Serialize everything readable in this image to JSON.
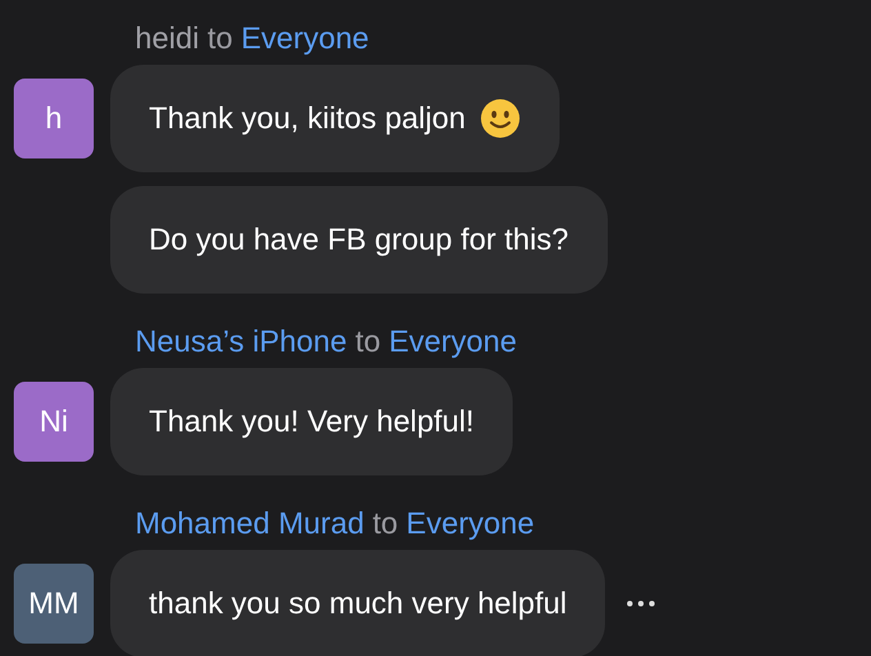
{
  "groups": [
    {
      "sender": "heidi",
      "color": "#a0a0a6",
      "connector": "to",
      "recipient": "Everyone",
      "avatar": {
        "initials": "h",
        "color": "#9b6bc8"
      },
      "messages": [
        {
          "text": "Thank you, kiitos paljon",
          "smiley": true,
          "more": false
        },
        {
          "text": "Do you have FB group for this?",
          "smiley": false,
          "more": false
        }
      ]
    },
    {
      "sender": "Neusa’s iPhone",
      "color": "#5b9cf0",
      "connector": "to",
      "recipient": "Everyone",
      "avatar": {
        "initials": "Ni",
        "color": "#9b6bc8"
      },
      "messages": [
        {
          "text": "Thank you! Very helpful!",
          "smiley": false,
          "more": false
        }
      ]
    },
    {
      "sender": "Mohamed Murad",
      "color": "#5b9cf0",
      "connector": "to",
      "recipient": "Everyone",
      "avatar": {
        "initials": "MM",
        "color": "#4d6076"
      },
      "messages": [
        {
          "text": "thank you so much very helpful",
          "smiley": false,
          "more": true
        }
      ]
    }
  ]
}
